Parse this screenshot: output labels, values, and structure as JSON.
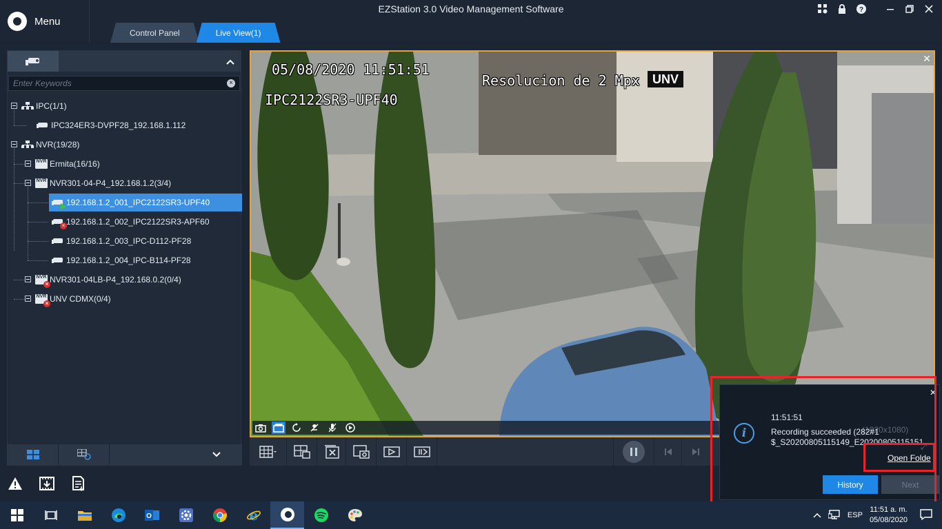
{
  "window": {
    "menu_label": "Menu",
    "title": "EZStation 3.0 Video Management Software"
  },
  "tabs": [
    {
      "label": "Control Panel"
    },
    {
      "label": "Live View(1)"
    }
  ],
  "left_panel": {
    "search_placeholder": "Enter Keywords",
    "tree": [
      {
        "label": "IPC(1/1)"
      },
      {
        "label": "IPC324ER3-DVPF28_192.168.1.112"
      },
      {
        "label": "NVR(19/28)"
      },
      {
        "label": "Ermita(16/16)"
      },
      {
        "label": "NVR301-04-P4_192.168.1.2(3/4)"
      },
      {
        "label": "192.168.1.2_001_IPC2122SR3-UPF40"
      },
      {
        "label": "192.168.1.2_002_IPC2122SR3-APF60"
      },
      {
        "label": "192.168.1.2_003_IPC-D112-PF28"
      },
      {
        "label": "192.168.1.2_004_IPC-B114-PF28"
      },
      {
        "label": "NVR301-04LB-P4_192.168.0.2(0/4)"
      },
      {
        "label": "UNV CDMX(0/4)"
      }
    ],
    "nvr_tag": "NVR"
  },
  "video": {
    "osd_datetime": "05/08/2020 11:51:51",
    "osd_camera": "IPC2122SR3-UPF40",
    "osd_resolution": "Resolucion de 2 Mpx",
    "osd_brand": "UNV"
  },
  "notification": {
    "time": "11:51:51",
    "message_line1": "Recording succeeded (282#1",
    "message_ghost": "...(1920x1080)",
    "message_line2": "$_S20200805115149_E20200805115151.",
    "open_folder": "Open Folde",
    "history_button": "History",
    "next_button": "Next"
  },
  "taskbar": {
    "language": "ESP",
    "time": "11:51 a. m.",
    "date": "05/08/2020"
  },
  "colors": {
    "accent": "#1f87e6",
    "selected_row": "#3d8fe0",
    "video_border": "#e8a43b",
    "highlight_box": "#e8232a"
  }
}
